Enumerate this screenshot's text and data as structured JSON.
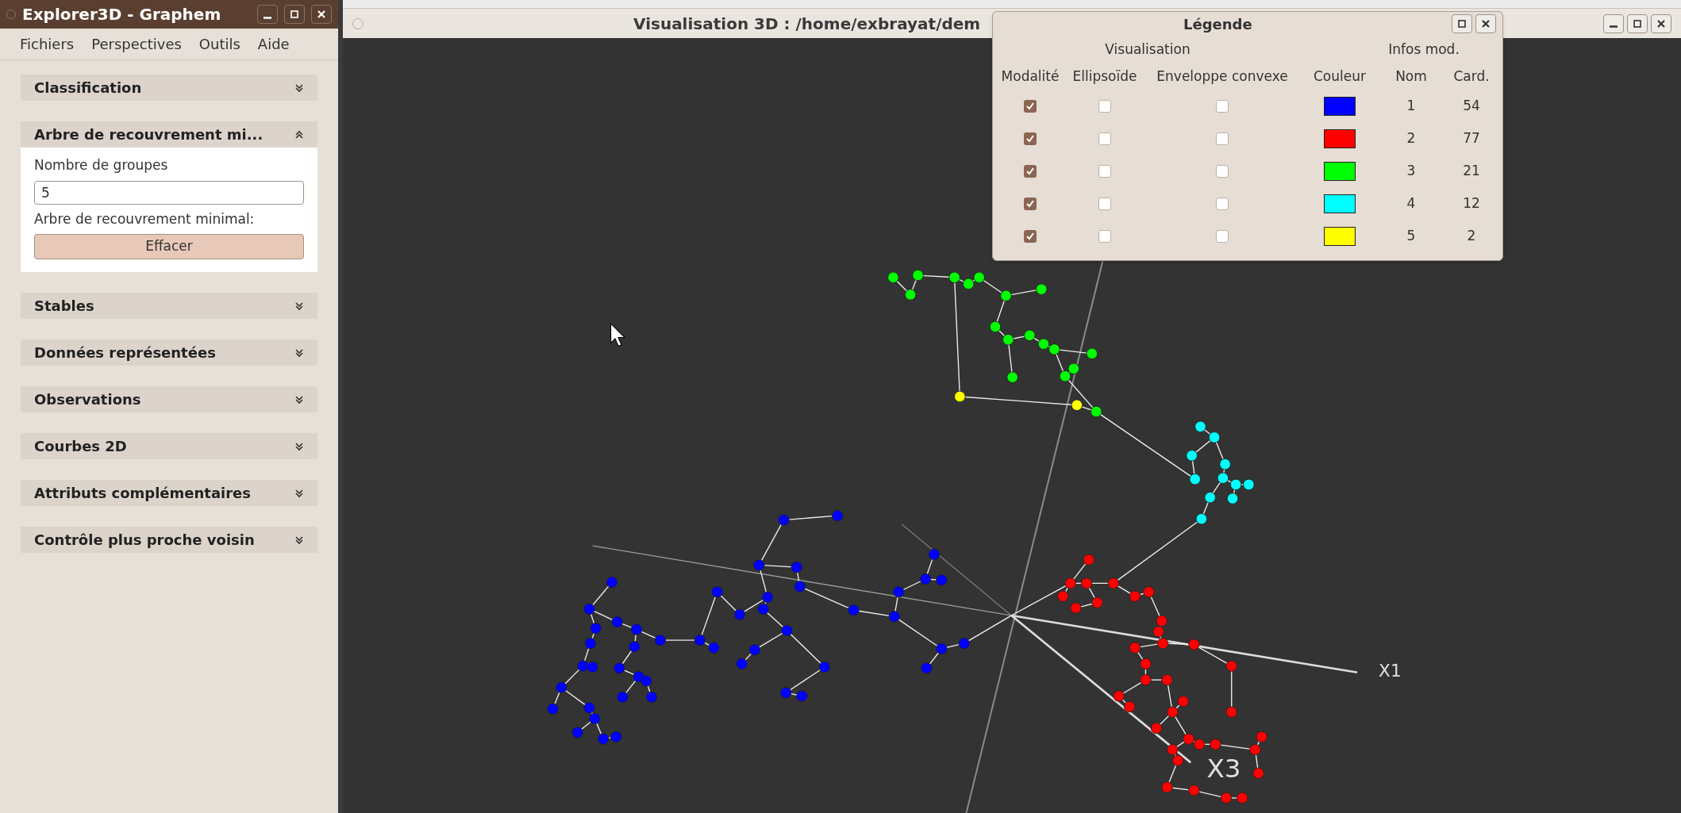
{
  "left_window": {
    "title": "Explorer3D - Graphem",
    "menu": [
      "Fichiers",
      "Perspectives",
      "Outils",
      "Aide"
    ],
    "sections": [
      {
        "title": "Classification",
        "expanded": false
      },
      {
        "title": "Arbre de recouvrement mi...",
        "expanded": true,
        "content": {
          "field_label": "Nombre de groupes",
          "field_value": "5",
          "caption": "Arbre de recouvrement minimal:",
          "button": "Effacer"
        }
      },
      {
        "title": "Stables",
        "expanded": false
      },
      {
        "title": "Données représentées",
        "expanded": false
      },
      {
        "title": "Observations",
        "expanded": false
      },
      {
        "title": "Courbes 2D",
        "expanded": false
      },
      {
        "title": "Attributs complémentaires",
        "expanded": false
      },
      {
        "title": "Contrôle plus proche voisin",
        "expanded": false
      }
    ]
  },
  "view_window": {
    "title": "Visualisation 3D : /home/exbrayat/dem",
    "axes": [
      {
        "label": "X1"
      },
      {
        "label": "X3"
      }
    ]
  },
  "legend": {
    "title": "Légende",
    "group_headers": [
      "Visualisation",
      "Infos mod."
    ],
    "columns": [
      "Modalité",
      "Ellipsoïde",
      "Enveloppe convexe",
      "Couleur",
      "Nom",
      "Card."
    ],
    "rows": [
      {
        "modality": true,
        "ellipsoid": false,
        "hull": false,
        "color": "#0000ff",
        "name": "1",
        "card": "54"
      },
      {
        "modality": true,
        "ellipsoid": false,
        "hull": false,
        "color": "#ff0000",
        "name": "2",
        "card": "77"
      },
      {
        "modality": true,
        "ellipsoid": false,
        "hull": false,
        "color": "#00ff00",
        "name": "3",
        "card": "21"
      },
      {
        "modality": true,
        "ellipsoid": false,
        "hull": false,
        "color": "#00ffff",
        "name": "4",
        "card": "12"
      },
      {
        "modality": true,
        "ellipsoid": false,
        "hull": false,
        "color": "#ffff00",
        "name": "5",
        "card": "2"
      }
    ]
  }
}
